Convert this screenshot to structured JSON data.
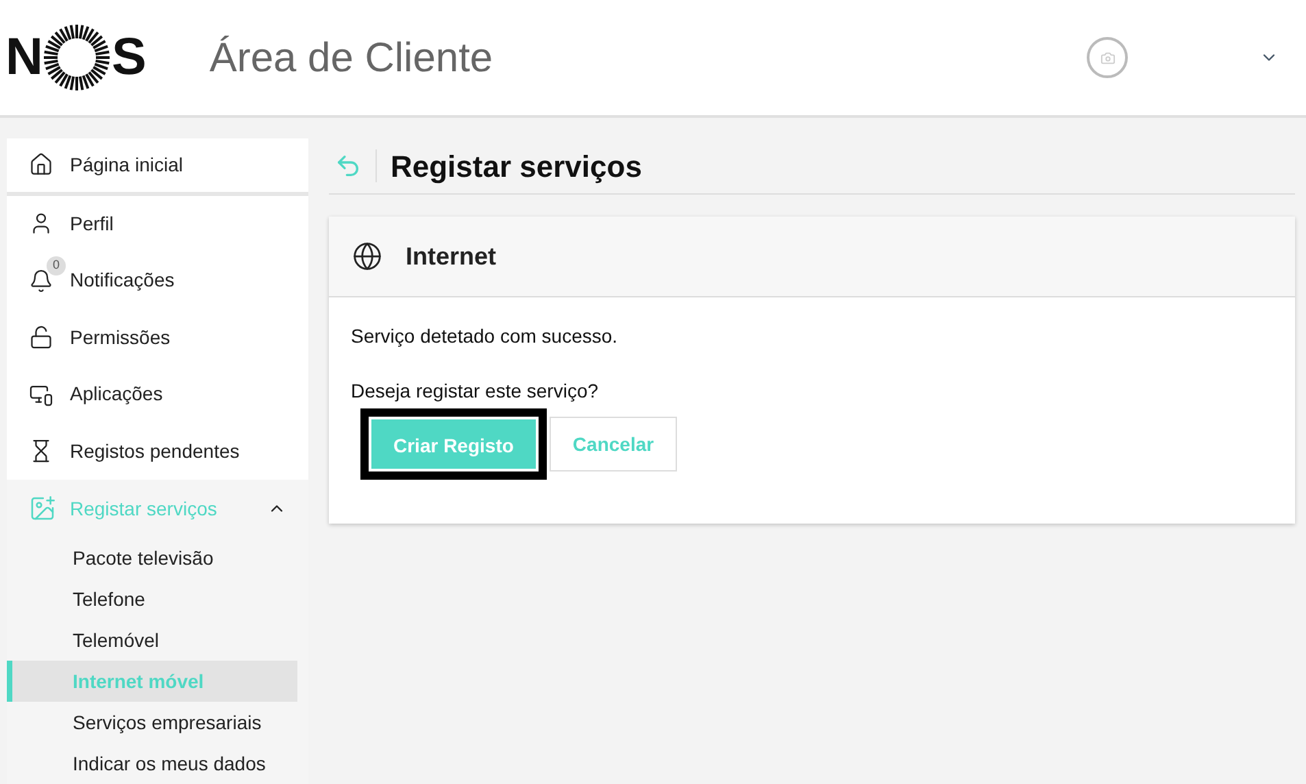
{
  "header": {
    "logo": [
      "N",
      "S"
    ],
    "title": "Área de Cliente"
  },
  "sidebar": {
    "items": [
      {
        "label": "Página inicial",
        "selected": false
      },
      {
        "label": "Perfil",
        "selected": false
      },
      {
        "label": "Notificações",
        "selected": false,
        "badge": "0"
      },
      {
        "label": "Permissões",
        "selected": false
      },
      {
        "label": "Aplicações",
        "selected": false
      },
      {
        "label": "Registos pendentes",
        "selected": false
      },
      {
        "label": "Registar serviços",
        "selected": true,
        "expanded": true,
        "children": [
          {
            "label": "Pacote televisão",
            "selected": false
          },
          {
            "label": "Telefone",
            "selected": false
          },
          {
            "label": "Telemóvel",
            "selected": false
          },
          {
            "label": "Internet móvel",
            "selected": true
          },
          {
            "label": "Serviços empresariais",
            "selected": false
          },
          {
            "label": "Indicar os meus dados",
            "selected": false
          }
        ]
      }
    ]
  },
  "page": {
    "title": "Registar serviços"
  },
  "card": {
    "title": "Internet",
    "message": "Serviço detetado com sucesso.",
    "question": "Deseja registar este serviço?",
    "buttons": [
      {
        "label": "Criar Registo",
        "kind": "primary",
        "focused": true
      },
      {
        "label": "Cancelar",
        "kind": "secondary",
        "focused": false
      }
    ]
  }
}
